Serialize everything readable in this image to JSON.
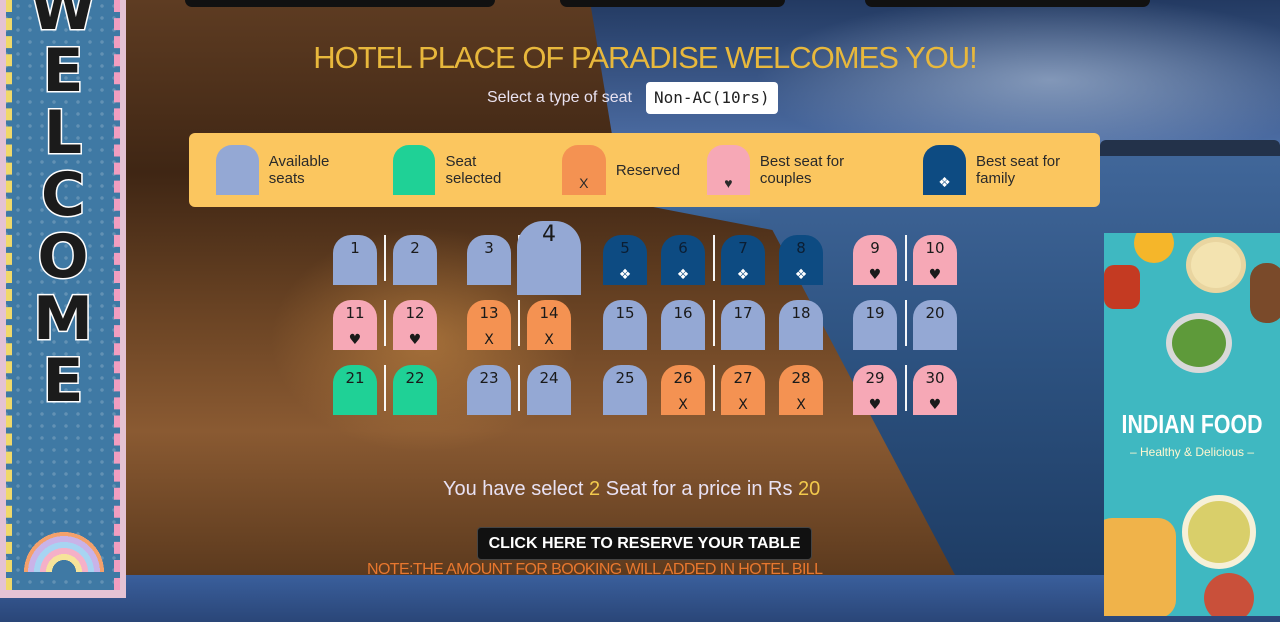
{
  "colors": {
    "available": "#94a8d4",
    "selected": "#1fd196",
    "reserved": "#f49252",
    "couples": "#f6a8b6",
    "family": "#0d4b82",
    "title": "#e8b83c",
    "legend_bg": "#fbc65f"
  },
  "banner": {
    "letters": [
      "W",
      "E",
      "L",
      "C",
      "O",
      "M",
      "E"
    ]
  },
  "header": {
    "title": "HOTEL PLACE OF PARADISE WELCOMES YOU!",
    "select_label": "Select a type of seat",
    "seat_type_value": "Non-AC(10rs)"
  },
  "legend": [
    {
      "label": "Available seats",
      "status": "available",
      "mark": ""
    },
    {
      "label": "Seat selected",
      "status": "selected",
      "mark": ""
    },
    {
      "label": "Reserved",
      "status": "reserved",
      "mark": "X"
    },
    {
      "label": "Best seat for couples",
      "status": "couples",
      "mark": "♥"
    },
    {
      "label": "Best seat for family",
      "status": "family",
      "mark": "❖"
    }
  ],
  "seats": [
    {
      "n": "1",
      "status": "available",
      "mark": ""
    },
    {
      "n": "2",
      "status": "available",
      "mark": ""
    },
    {
      "n": "3",
      "status": "available",
      "mark": ""
    },
    {
      "n": "4",
      "status": "available",
      "mark": "",
      "hovered": true
    },
    {
      "n": "5",
      "status": "family",
      "mark": "❖"
    },
    {
      "n": "6",
      "status": "family",
      "mark": "❖"
    },
    {
      "n": "7",
      "status": "family",
      "mark": "❖"
    },
    {
      "n": "8",
      "status": "family",
      "mark": "❖"
    },
    {
      "n": "9",
      "status": "couples",
      "mark": "♥"
    },
    {
      "n": "10",
      "status": "couples",
      "mark": "♥"
    },
    {
      "n": "11",
      "status": "couples",
      "mark": "♥"
    },
    {
      "n": "12",
      "status": "couples",
      "mark": "♥"
    },
    {
      "n": "13",
      "status": "reserved",
      "mark": "X"
    },
    {
      "n": "14",
      "status": "reserved",
      "mark": "X"
    },
    {
      "n": "15",
      "status": "available",
      "mark": ""
    },
    {
      "n": "16",
      "status": "available",
      "mark": ""
    },
    {
      "n": "17",
      "status": "available",
      "mark": ""
    },
    {
      "n": "18",
      "status": "available",
      "mark": ""
    },
    {
      "n": "19",
      "status": "available",
      "mark": ""
    },
    {
      "n": "20",
      "status": "available",
      "mark": ""
    },
    {
      "n": "21",
      "status": "selected",
      "mark": ""
    },
    {
      "n": "22",
      "status": "selected",
      "mark": ""
    },
    {
      "n": "23",
      "status": "available",
      "mark": ""
    },
    {
      "n": "24",
      "status": "available",
      "mark": ""
    },
    {
      "n": "25",
      "status": "available",
      "mark": ""
    },
    {
      "n": "26",
      "status": "reserved",
      "mark": "X"
    },
    {
      "n": "27",
      "status": "reserved",
      "mark": "X"
    },
    {
      "n": "28",
      "status": "reserved",
      "mark": "X"
    },
    {
      "n": "29",
      "status": "couples",
      "mark": "♥"
    },
    {
      "n": "30",
      "status": "couples",
      "mark": "♥"
    }
  ],
  "summary": {
    "prefix": "You have select",
    "count": "2",
    "middle": "Seat for a price in Rs",
    "price": "20"
  },
  "reserve_button": "CLICK HERE TO RESERVE YOUR TABLE",
  "note": "NOTE:THE AMOUNT FOR BOOKING WILL ADDED IN HOTEL BILL",
  "ad": {
    "title": "INDIAN FOOD",
    "subtitle": "– Healthy & Delicious –"
  }
}
